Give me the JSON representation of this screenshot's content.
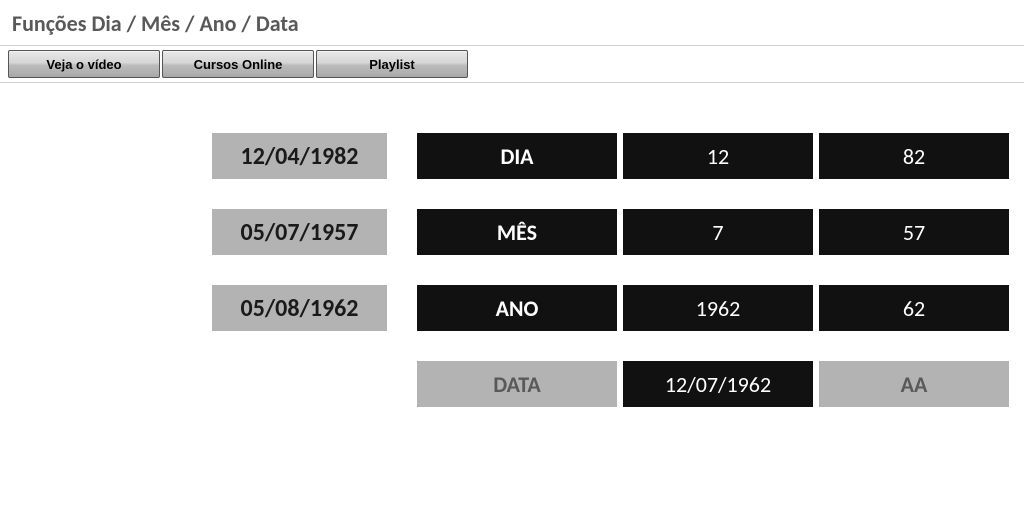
{
  "header": {
    "title": "Funções Dia / Mês / Ano / Data"
  },
  "buttons": {
    "video": "Veja o vídeo",
    "cursos": "Cursos Online",
    "playlist": "Playlist"
  },
  "rows": [
    {
      "date": "12/04/1982",
      "label": "DIA",
      "v1": "12",
      "v2": "82"
    },
    {
      "date": "05/07/1957",
      "label": "MÊS",
      "v1": "7",
      "v2": "57"
    },
    {
      "date": "05/08/1962",
      "label": "ANO",
      "v1": "1962",
      "v2": "62"
    }
  ],
  "footer": {
    "label": "DATA",
    "v1": "12/07/1962",
    "v2": "AA"
  }
}
